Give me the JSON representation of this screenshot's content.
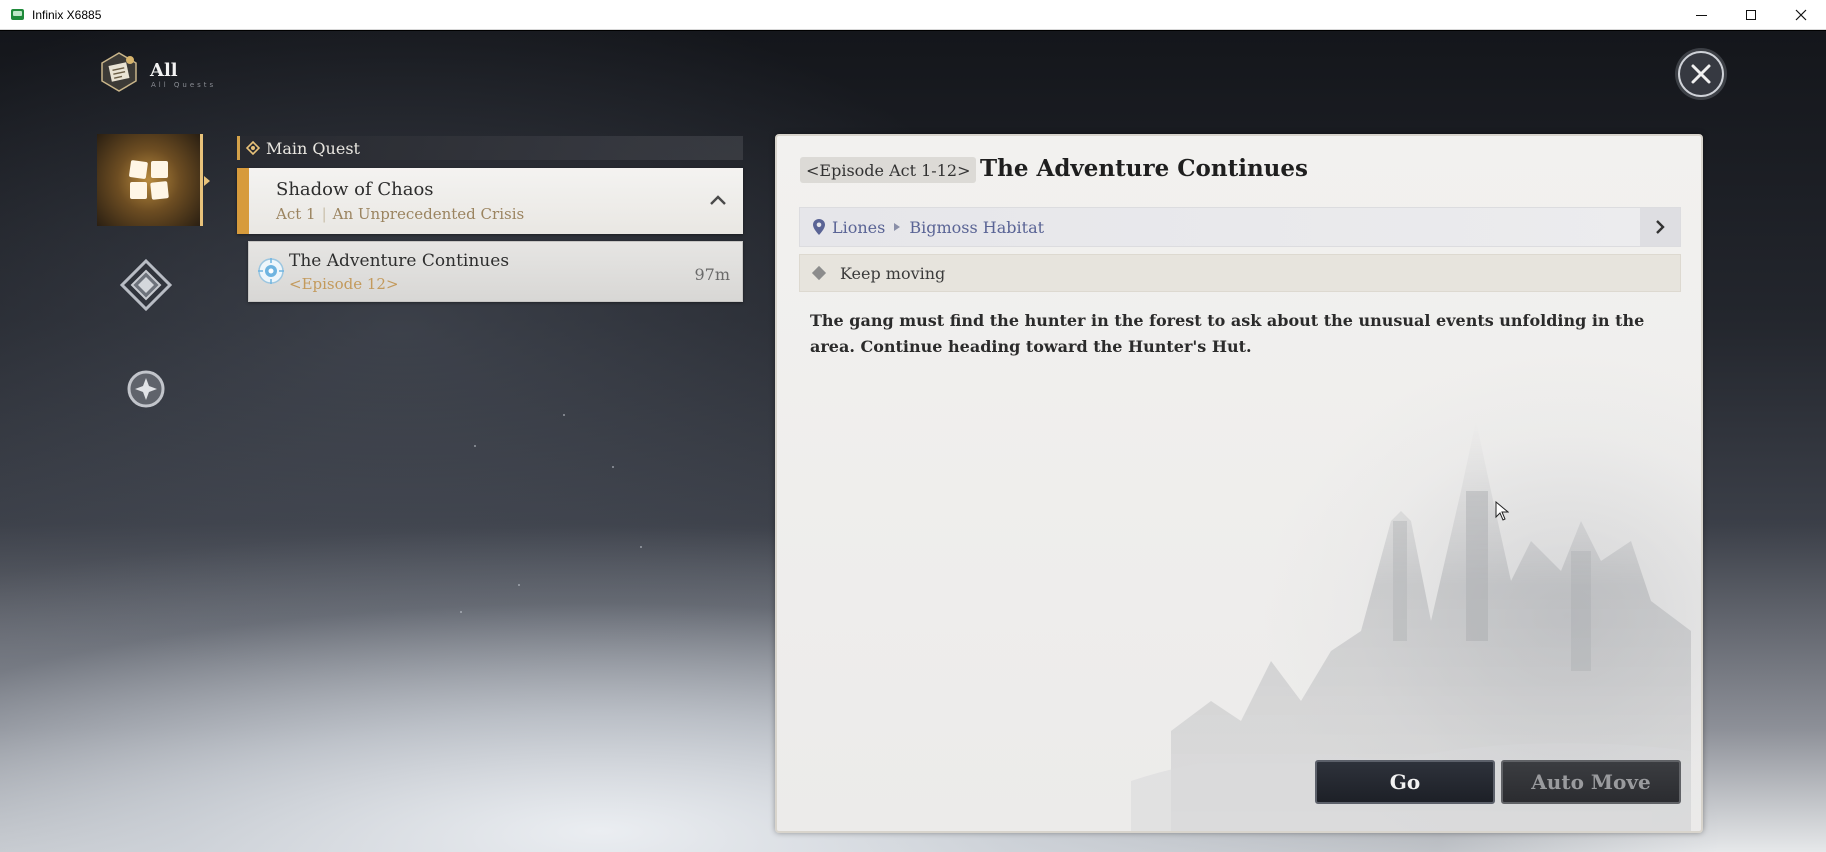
{
  "window": {
    "title": "Infinix X6885"
  },
  "header": {
    "title": "All",
    "subtitle": "All Quests"
  },
  "nav": {
    "items": [
      {
        "icon": "quest-grid-icon",
        "active": true
      },
      {
        "icon": "diamond-compass-icon",
        "active": false
      },
      {
        "icon": "star-circle-icon",
        "active": false
      }
    ]
  },
  "quest_list": {
    "section_label": "Main Quest",
    "chapter": {
      "title": "Shadow of Chaos",
      "act": "Act 1",
      "act_name": "An Unprecedented Crisis"
    },
    "items": [
      {
        "title": "The Adventure Continues",
        "episode": "<Episode 12>",
        "distance": "97m"
      }
    ]
  },
  "detail": {
    "episode_badge": "<Episode Act 1-12>",
    "title": "The Adventure Continues",
    "location": {
      "region": "Liones",
      "area": "Bigmoss Habitat"
    },
    "objective": "Keep moving",
    "description": "The gang must find the hunter in the forest to ask about the unusual events unfolding in the area. Continue heading toward the Hunter's Hut.",
    "buttons": {
      "go": "Go",
      "auto_move": "Auto Move"
    }
  },
  "colors": {
    "accent_gold": "#d79b3c",
    "location_text": "#5a6495",
    "episode_text": "#c39a5c"
  }
}
